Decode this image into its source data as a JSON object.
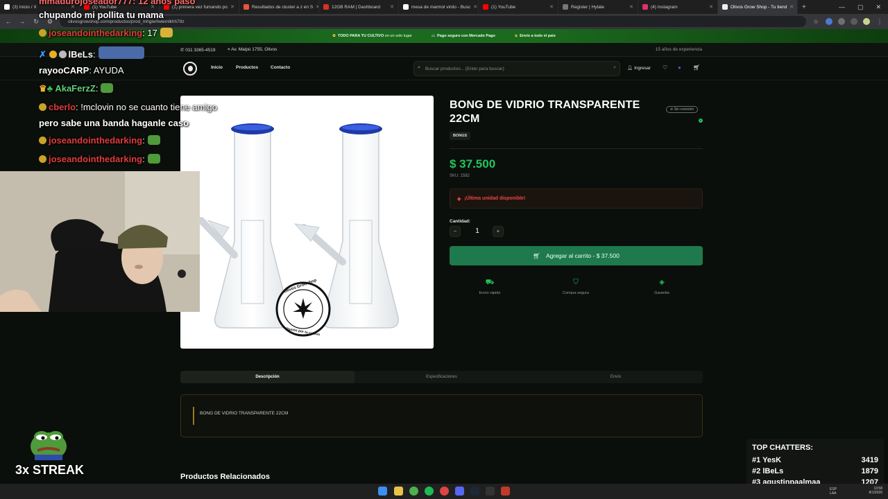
{
  "browser": {
    "tabs": [
      {
        "label": "(3) Inicio / X",
        "color": "#ffffff"
      },
      {
        "label": "(1) YouTube",
        "color": "#ff0000"
      },
      {
        "label": "(1) primera vez fumando po",
        "color": "#ff0000"
      },
      {
        "label": "Resultados de cluster a z en S",
        "color": "#e8553b"
      },
      {
        "label": "12GB RAM | Dashboard",
        "color": "#d93025"
      },
      {
        "label": "mesa de marmol vinilo - Busc",
        "color": "#ffffff"
      },
      {
        "label": "(1) YouTube",
        "color": "#ff0000"
      },
      {
        "label": "Register | Hytale",
        "color": "#777777"
      },
      {
        "label": "(4) Instagram",
        "color": "#e1306c"
      },
      {
        "label": "Olivos Grow Shop - Tu tiend",
        "color": "#111111"
      }
    ],
    "new_tab": "+",
    "url": "olivosgrowshop.com/productos/prod_mhgiw0wlemlkhh79z"
  },
  "promo": [
    {
      "icon": "plant-icon",
      "text": "TODO PARA TU CULTIVO",
      "sub": "en un solo lugar"
    },
    {
      "icon": "card-icon",
      "text": "Pago seguro con Mercado Pago",
      "sub": ""
    },
    {
      "icon": "box-icon",
      "text": "Envío a todo el país",
      "sub": ""
    }
  ],
  "info": {
    "phone": "011 3365-4519",
    "address": "Av. Maipú 1755, Olivos",
    "experience": "15 años de experiencia"
  },
  "nav": {
    "links": [
      "Inicio",
      "Productos",
      "Contacto"
    ],
    "search_placeholder": "Buscar productos... (Enter para buscar)",
    "login": "Ingresar",
    "cart_count": "0"
  },
  "product": {
    "title": "BONG DE VIDRIO TRANSPARENTE 22CM",
    "connection": "Sin conexión",
    "category": "BONGS",
    "price": "$ 37.500",
    "sku": "SKU: 1582",
    "stock": "¡Última unidad disponible!",
    "qty_label": "Cantidad:",
    "qty": "1",
    "minus": "−",
    "plus": "+",
    "add_to_cart": "Agregar al carrito - $ 37.500",
    "features": [
      "Envío rápido",
      "Compra segura",
      "Garantía"
    ],
    "watermark_top": "Olivos Growshop",
    "watermark_bottom": "Pasión por tu cultivo"
  },
  "tabs": [
    "Descripción",
    "Especificaciones",
    "Envío"
  ],
  "description": "BONG DE VIDRIO TRANSPARENTE 22CM",
  "related_title": "Productos Relacionados",
  "overlay": {
    "chat": [
      {
        "user": "chupando mi pollita tu mama",
        "msg": "",
        "user_color": "#ffffff"
      },
      {
        "user": "joseandointhedarking",
        "msg": ": 17",
        "user_color": "#e03b3b"
      },
      {
        "user": "lBeLs",
        "msg": ":",
        "user_color": "#ffffff"
      },
      {
        "user": "rayooCARP",
        "msg": ": AYUDA",
        "user_color": "#ffffff"
      },
      {
        "user": "AkaFerzZ",
        "msg": ":",
        "user_color": "#ffffff"
      },
      {
        "user": "cberlo",
        "msg": ": !mclovin no se cuanto tiene amigo",
        "user_color": "#e03b3b"
      },
      {
        "user": "",
        "msg": "pero sabe una banda haganle caso",
        "user_color": "#ffffff"
      },
      {
        "user": "joseandointhedarking",
        "msg": ":",
        "user_color": "#e03b3b"
      },
      {
        "user": "joseandointhedarking",
        "msg": ":",
        "user_color": "#e03b3b"
      }
    ],
    "top_chat_partial": "mmadurojoseador777: 12 años paso",
    "streak": "3x STREAK",
    "top_chatters": {
      "title": "TOP CHATTERS:",
      "rows": [
        {
          "rank": "#1",
          "name": "YesK",
          "count": "3419"
        },
        {
          "rank": "#2",
          "name": "lBeLs",
          "count": "1879"
        },
        {
          "rank": "#3",
          "name": "agustinpaalmaa",
          "count": "1207"
        }
      ]
    }
  },
  "taskbar": {
    "lang": "ESP\nLAA",
    "time": "13:58",
    "date": "8/1/2026"
  },
  "colors": {
    "accent_green": "#22c55e",
    "cart_button": "#1e7a4c",
    "stock_red": "#ef4444"
  }
}
